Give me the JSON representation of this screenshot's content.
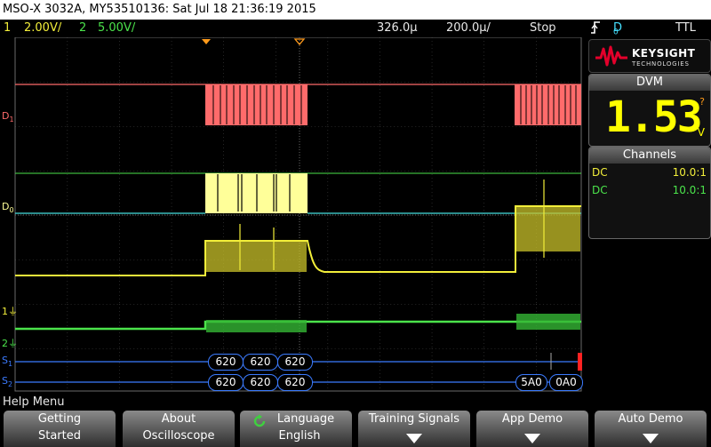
{
  "title_bar": {
    "text": "MSO-X 3032A, MY53510136: Sat Jul 18 21:36:19 2015"
  },
  "status_bar": {
    "ch1_num": "1",
    "ch1_scale": "2.00V/",
    "ch2_num": "2",
    "ch2_scale": "5.00V/",
    "time_pos": "326.0µ",
    "time_scale": "200.0µ/",
    "run_state": "Stop",
    "trigger_icon": "trigger-edge-icon",
    "trigger_source": "D",
    "trigger_source_sub": "0",
    "trigger_type": "TTL"
  },
  "labels": {
    "d1": "D",
    "d1_sub": "1",
    "d0": "D",
    "d0_sub": "0",
    "ch1_marker": "1",
    "ch2_marker": "2",
    "s1": "S",
    "s1_sub": "1",
    "s2": "S",
    "s2_sub": "2"
  },
  "bus": {
    "s1_packets": [
      "620",
      "620",
      "620"
    ],
    "s2_packets": [
      "620",
      "620",
      "620",
      "5A0",
      "0A0"
    ]
  },
  "brand": {
    "name": "KEYSIGHT",
    "sub": "TECHNOLOGIES",
    "icon": "keysight-wave-logo-icon"
  },
  "dvm": {
    "header": "DVM",
    "value": "1.53",
    "unit": "V",
    "help": "?"
  },
  "channels": {
    "header": "Channels",
    "rows": [
      {
        "coupling": "DC",
        "probe": "10.0:1",
        "color": "#f2ee3a"
      },
      {
        "coupling": "DC",
        "probe": "10.0:1",
        "color": "#4be34b"
      }
    ]
  },
  "help_menu": {
    "label": "Help Menu"
  },
  "softkeys": [
    {
      "line1": "Getting",
      "line2": "Started"
    },
    {
      "line1": "About",
      "line2": "Oscilloscope"
    },
    {
      "line1": "Language",
      "line2": "English",
      "icon": "rotate-knob-icon"
    },
    {
      "line1": "Training Signals",
      "line2": "",
      "icon": "down-arrow-icon"
    },
    {
      "line1": "App Demo",
      "line2": "",
      "icon": "down-arrow-icon"
    },
    {
      "line1": "Auto Demo",
      "line2": "",
      "icon": "down-arrow-icon"
    }
  ],
  "colors": {
    "ch1": "#f2ee3a",
    "ch2": "#4be34b",
    "d1": "#ff6b6b",
    "d0": "#ffff99",
    "bus": "#3b7bff",
    "dvm_digits": "#ffff00"
  }
}
